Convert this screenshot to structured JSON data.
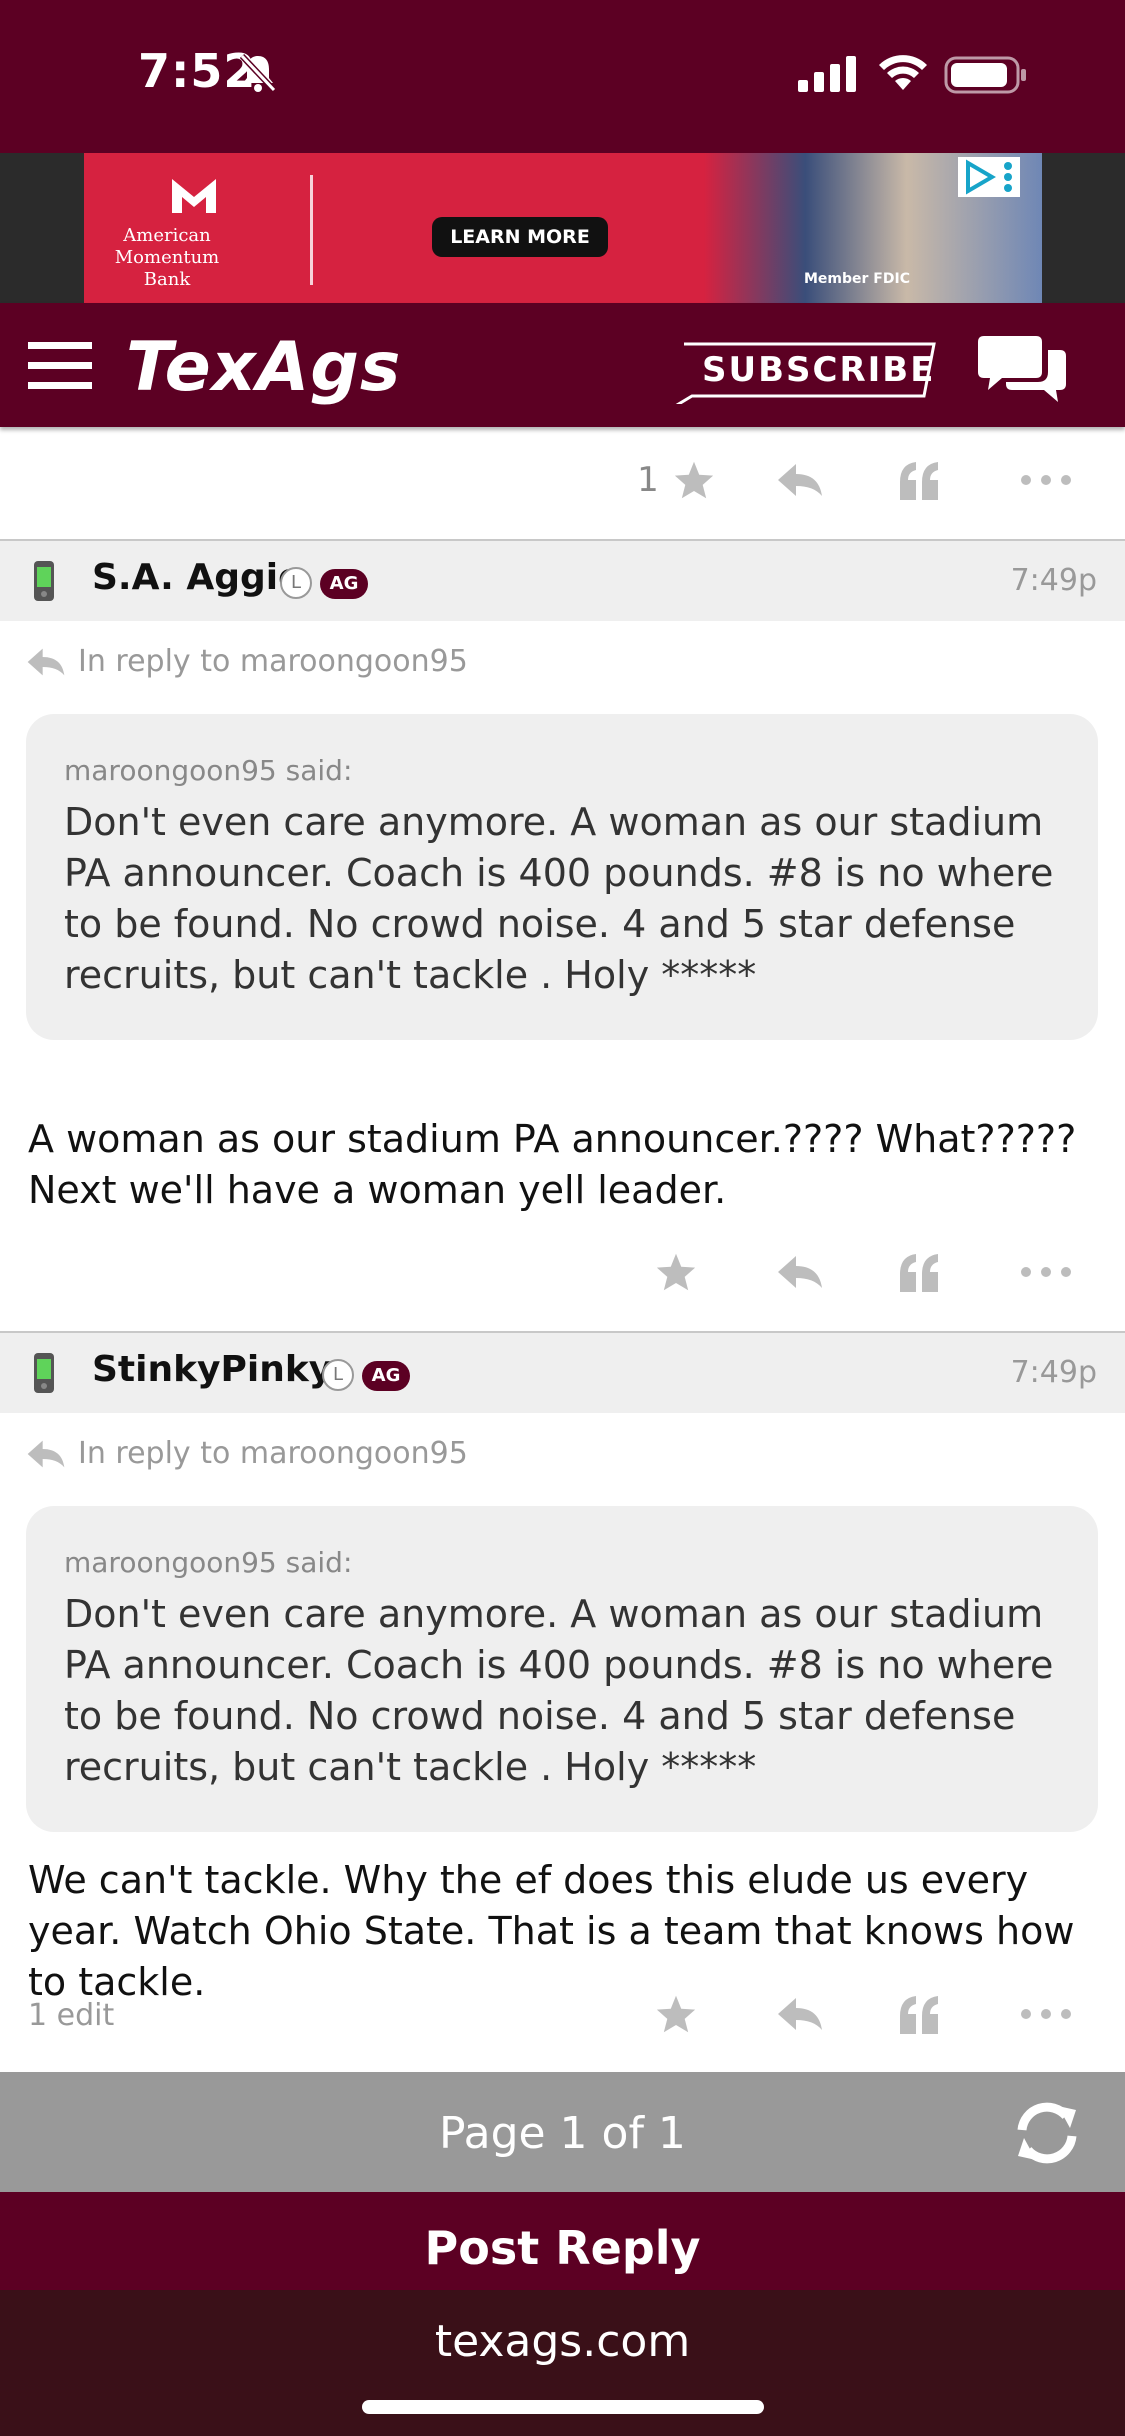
{
  "status_bar": {
    "time": "7:52"
  },
  "ad": {
    "brand_line1": "American",
    "brand_line2": "Momentum Bank",
    "cta": "LEARN MORE",
    "fdic": "Member FDIC"
  },
  "header": {
    "logo": "TexAgs",
    "subscribe": "SUBSCRIBE"
  },
  "top_actions": {
    "star_count": "1"
  },
  "posts": [
    {
      "username": "S.A. Aggie",
      "badge_l": "L",
      "badge_ag": "AG",
      "time": "7:49p",
      "in_reply_to": "In reply to maroongoon95",
      "quote_said": "maroongoon95 said:",
      "quote_text": "Don't even care anymore. A woman as our stadium PA announcer. Coach is 400 pounds. #8 is no where to be found. No crowd noise. 4 and 5 star defense recruits, but can't tackle . Holy *****",
      "body": "A woman as our stadium PA announcer.???? What????? Next we'll have a woman yell leader."
    },
    {
      "username": "StinkyPinky",
      "badge_l": "L",
      "badge_ag": "AG",
      "time": "7:49p",
      "in_reply_to": "In reply to maroongoon95",
      "quote_said": "maroongoon95 said:",
      "quote_text": "Don't even care anymore. A woman as our stadium PA announcer. Coach is 400 pounds. #8 is no where to be found. No crowd noise. 4 and 5 star defense recruits, but can't tackle . Holy *****",
      "body": "We can't tackle. Why the ef does this elude us every year. Watch Ohio State. That is a team that knows how to tackle.",
      "edit_note": "1 edit"
    }
  ],
  "pager": {
    "text": "Page 1 of 1"
  },
  "post_reply": "Post Reply",
  "browser": {
    "url": "texags.com"
  },
  "icons": {
    "star": "star-icon",
    "reply": "reply-icon",
    "quote": "quote-icon",
    "more": "more-icon",
    "refresh": "refresh-icon",
    "chat": "chat-icon",
    "menu": "hamburger-icon",
    "phone": "mobile-phone-icon"
  },
  "colors": {
    "maroon": "#5c0023",
    "gray_bar": "#999999",
    "post_header_bg": "#efefef"
  }
}
